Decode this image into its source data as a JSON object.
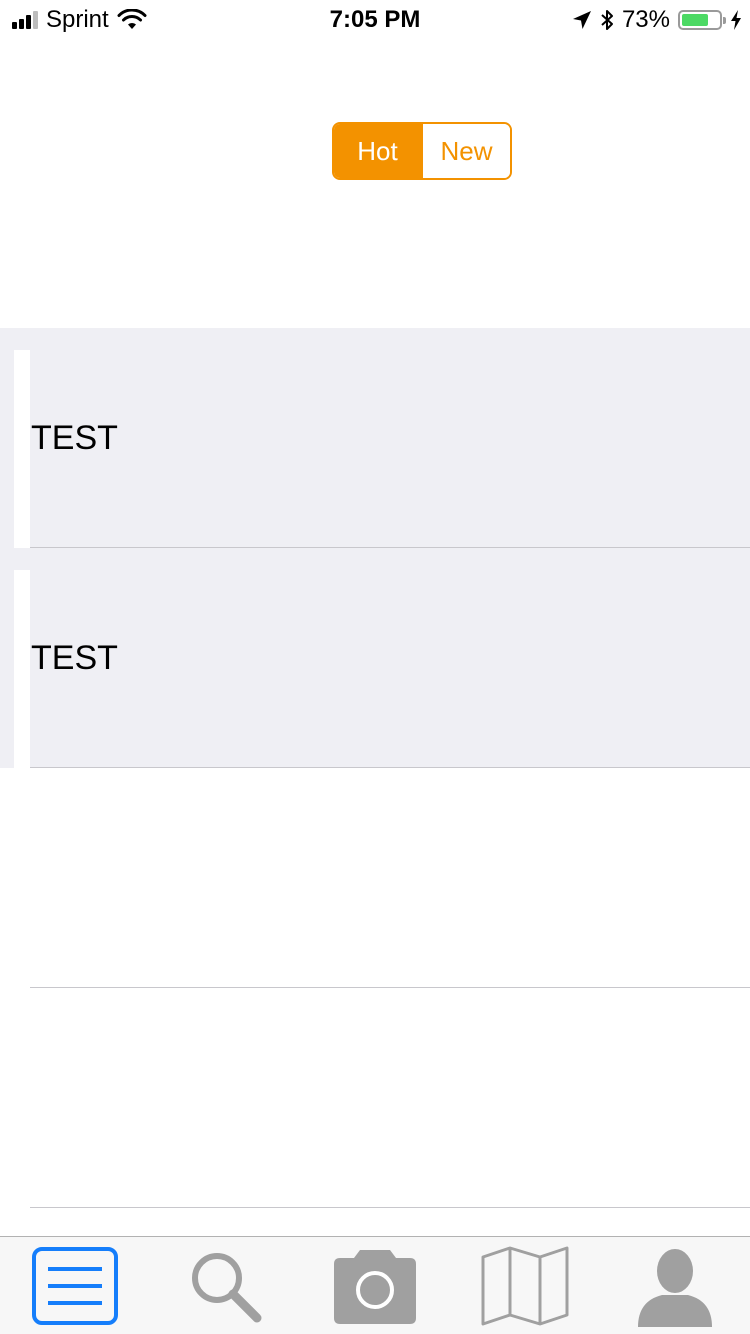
{
  "status_bar": {
    "carrier": "Sprint",
    "time": "7:05 PM",
    "battery_percent": "73%",
    "battery_level": 0.73,
    "battery_color": "#4cd964"
  },
  "segmented_control": {
    "options": [
      {
        "label": "Hot",
        "selected": true
      },
      {
        "label": "New",
        "selected": false
      }
    ],
    "accent_color": "#f39200"
  },
  "feed": {
    "rows": [
      {
        "text": "TEST"
      },
      {
        "text": "TEST"
      }
    ]
  },
  "tab_bar": {
    "tabs": [
      {
        "icon": "list-icon",
        "selected": true
      },
      {
        "icon": "search-icon",
        "selected": false
      },
      {
        "icon": "camera-icon",
        "selected": false
      },
      {
        "icon": "map-icon",
        "selected": false
      },
      {
        "icon": "profile-icon",
        "selected": false
      }
    ],
    "selected_color": "#157efb",
    "inactive_color": "#a0a0a0"
  }
}
